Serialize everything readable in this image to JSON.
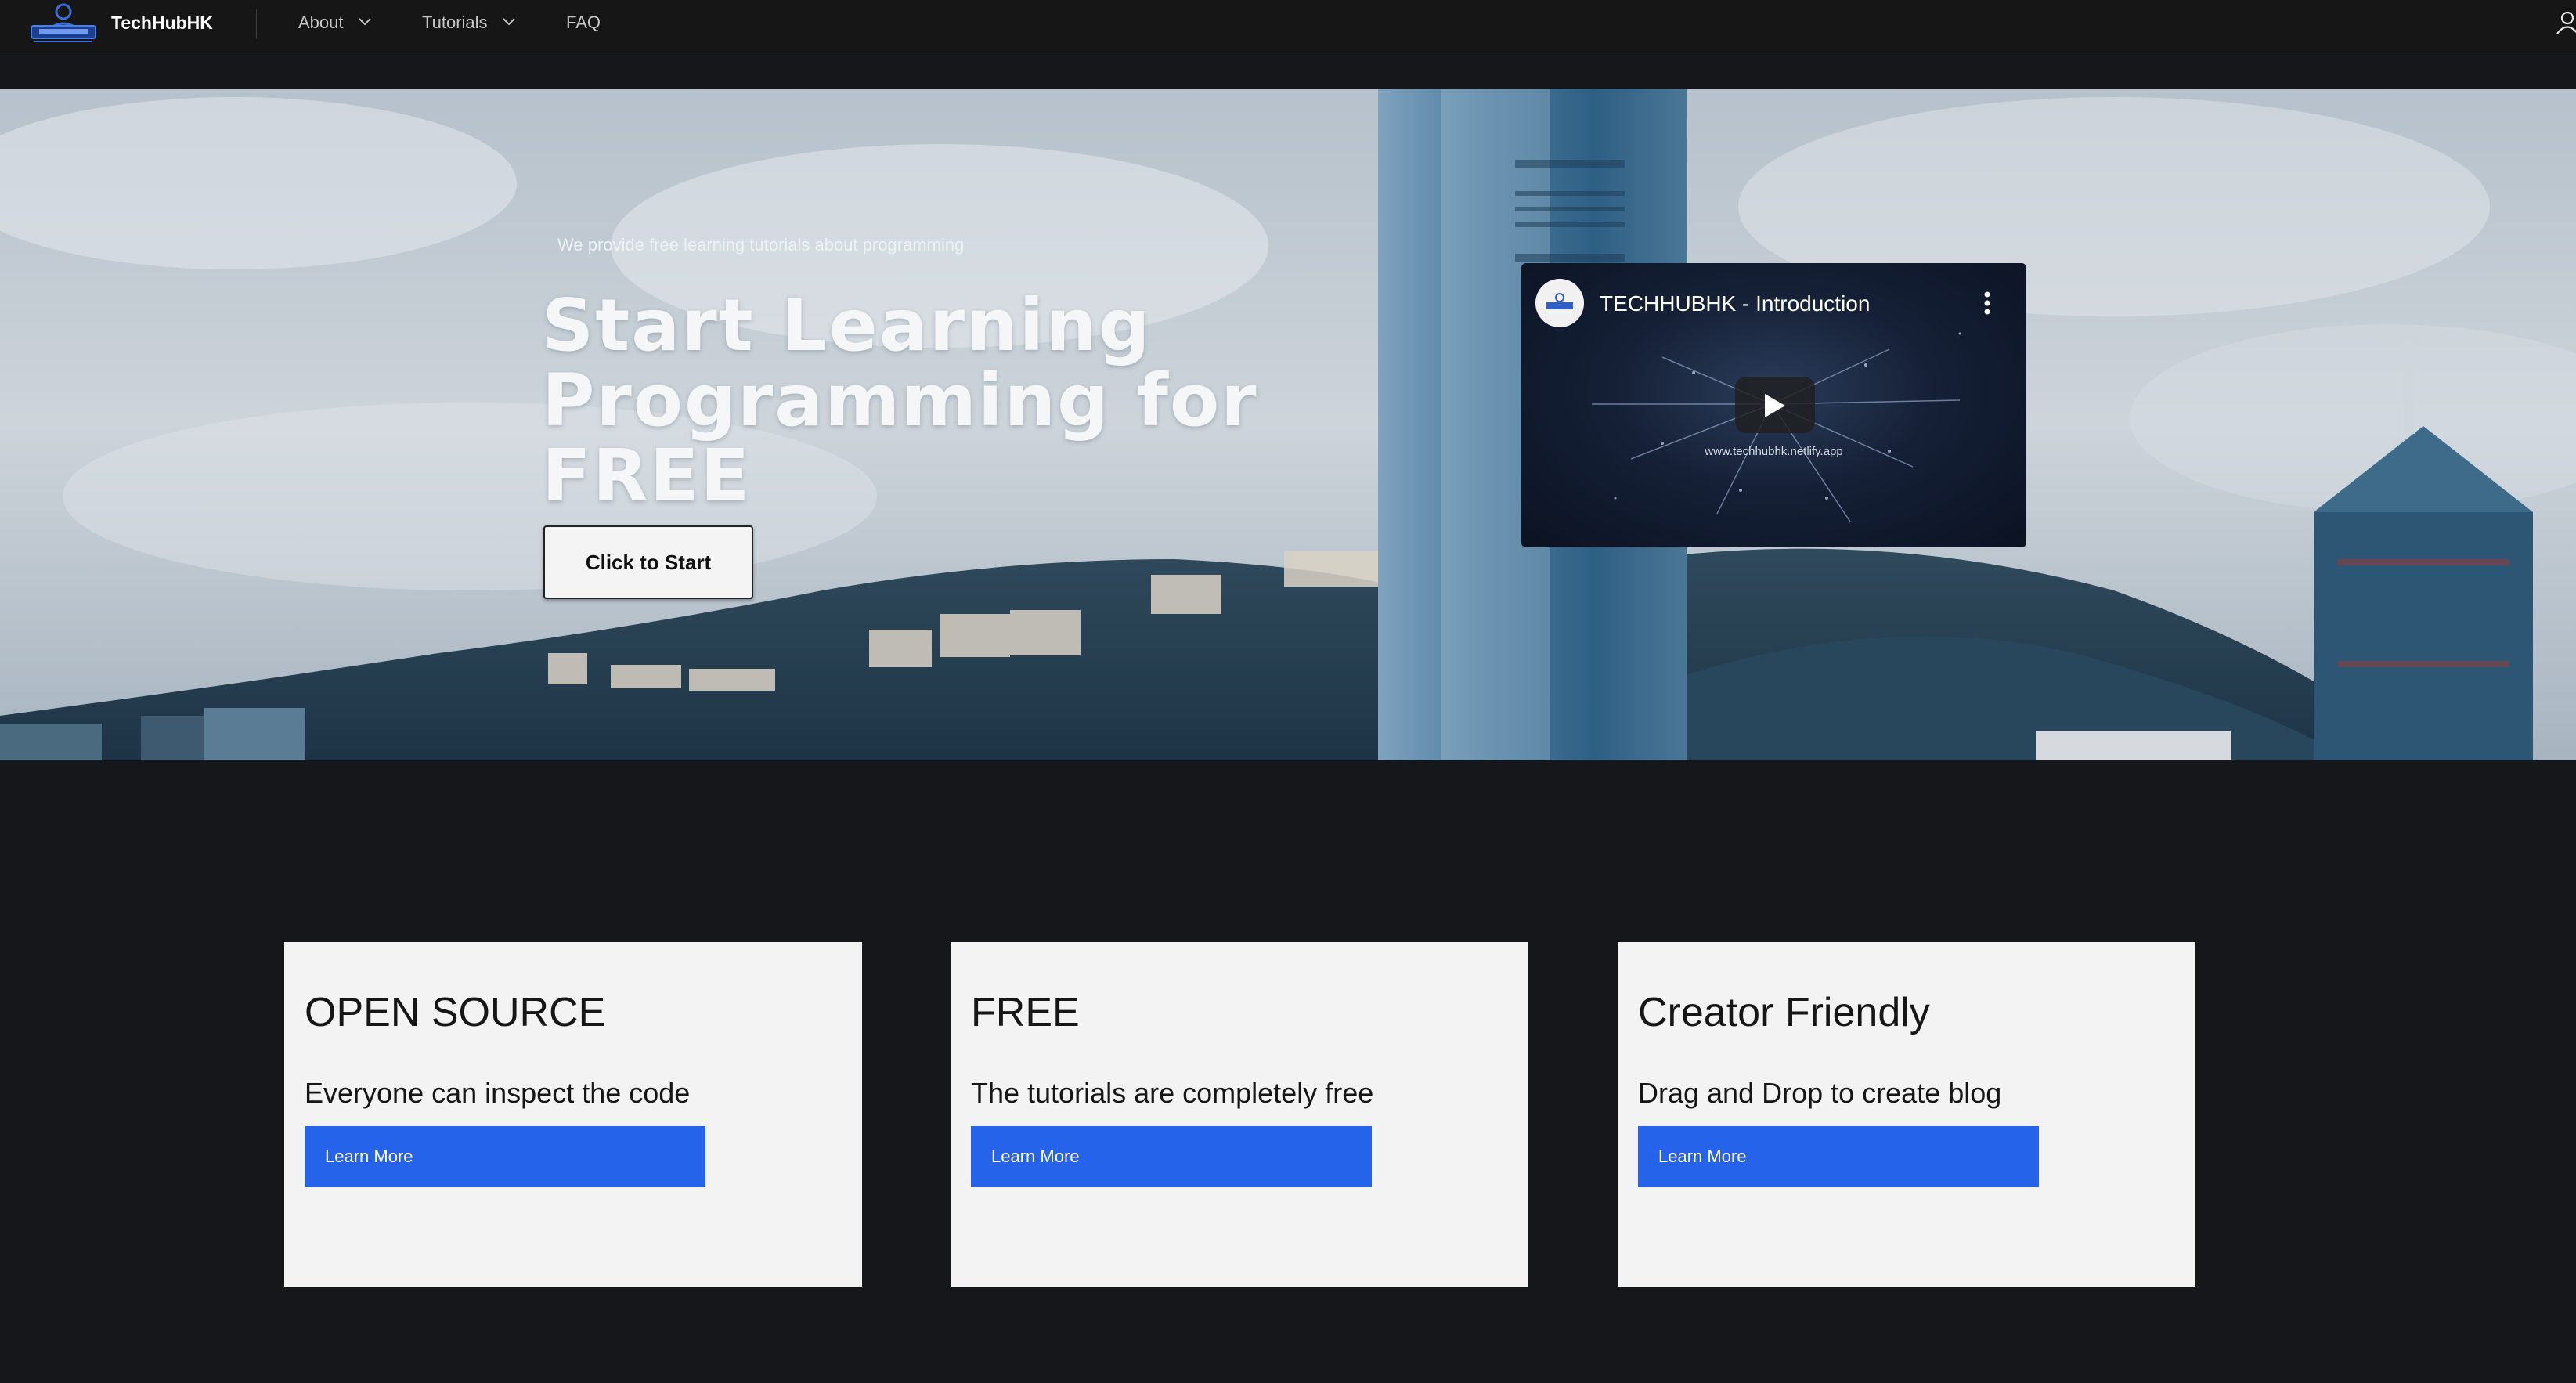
{
  "header": {
    "brand": "TechHubHK",
    "nav": [
      {
        "label": "About",
        "has_dropdown": true
      },
      {
        "label": "Tutorials",
        "has_dropdown": true
      },
      {
        "label": "FAQ",
        "has_dropdown": false
      }
    ],
    "icons": {
      "logo": "techhubhk-logo",
      "user": "user-icon",
      "dropdown": "chevron-down-icon"
    }
  },
  "hero": {
    "tagline": "We provide free learning tutorials about programming",
    "title_line1": "Start Learning",
    "title_line2": "Programming for FREE",
    "cta_label": "Click to Start",
    "video": {
      "title": "TECHHUBHK - Introduction",
      "url_text": "www.techhubhk.netlify.app",
      "icons": {
        "channel": "channel-avatar-icon",
        "menu": "more-vert-icon",
        "play": "play-icon"
      }
    }
  },
  "features": [
    {
      "title": "OPEN SOURCE",
      "description": "Everyone can inspect the code",
      "button": "Learn More"
    },
    {
      "title": "FREE",
      "description": "The tutorials are completely free",
      "button": "Learn More"
    },
    {
      "title": "Creator Friendly",
      "description": "Drag and Drop to create blog",
      "button": "Learn More"
    }
  ],
  "colors": {
    "header_bg": "#161616",
    "page_bg": "#15171a",
    "card_bg": "#f3f3f3",
    "button_blue": "#2563eb"
  }
}
